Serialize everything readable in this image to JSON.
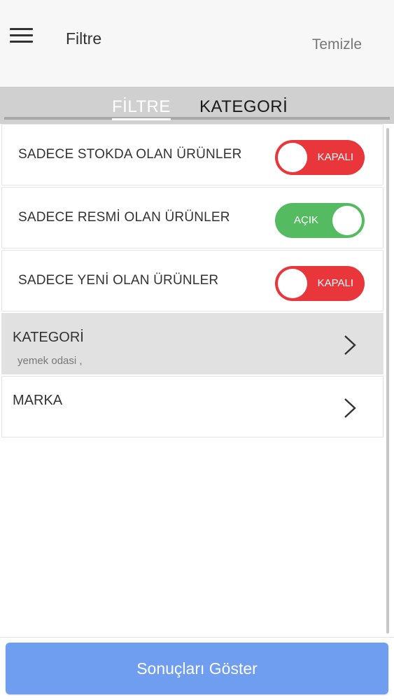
{
  "header": {
    "title": "Filtre",
    "clear_label": "Temizle",
    "menu_icon": "hamburger-menu-icon"
  },
  "tabs": [
    {
      "label": "FİLTRE",
      "active": true
    },
    {
      "label": "KATEGORİ",
      "active": false
    }
  ],
  "filters": [
    {
      "label": "SADECE STOKDA OLAN ÜRÜNLER",
      "state": "KAPALI",
      "on": false
    },
    {
      "label": "SADECE RESMİ OLAN ÜRÜNLER",
      "state": "AÇIK",
      "on": true
    },
    {
      "label": "SADECE YENİ OLAN ÜRÜNLER",
      "state": "KAPALI",
      "on": false
    }
  ],
  "nav": [
    {
      "title": "KATEGORİ",
      "subtitle": "yemek odasi ,"
    },
    {
      "title": "MARKA",
      "subtitle": ""
    }
  ],
  "footer": {
    "show_results_label": "Sonuçları Göster"
  },
  "colors": {
    "toggle_off": "#e8363b",
    "toggle_on": "#55bb60",
    "primary_button": "#6f9df0",
    "selected_row": "#e1e1e1"
  }
}
